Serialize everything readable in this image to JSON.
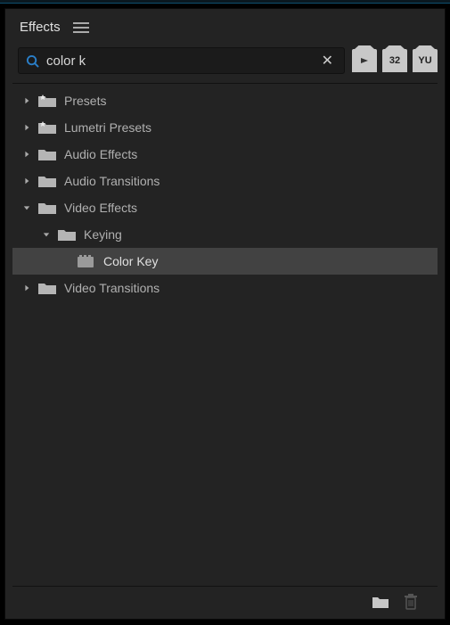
{
  "panel": {
    "title": "Effects"
  },
  "search": {
    "value": "color k",
    "placeholder": ""
  },
  "filters": {
    "fx": "▸",
    "accelerated": "32",
    "yuv": "YU"
  },
  "tree": [
    {
      "label": "Presets",
      "type": "preset-folder",
      "level": 0,
      "expanded": false,
      "hasChildren": true,
      "selected": false
    },
    {
      "label": "Lumetri Presets",
      "type": "preset-folder",
      "level": 0,
      "expanded": false,
      "hasChildren": true,
      "selected": false
    },
    {
      "label": "Audio Effects",
      "type": "folder",
      "level": 0,
      "expanded": false,
      "hasChildren": true,
      "selected": false
    },
    {
      "label": "Audio Transitions",
      "type": "folder",
      "level": 0,
      "expanded": false,
      "hasChildren": true,
      "selected": false
    },
    {
      "label": "Video Effects",
      "type": "folder",
      "level": 0,
      "expanded": true,
      "hasChildren": true,
      "selected": false
    },
    {
      "label": "Keying",
      "type": "folder",
      "level": 1,
      "expanded": true,
      "hasChildren": true,
      "selected": false
    },
    {
      "label": "Color Key",
      "type": "effect",
      "level": 2,
      "expanded": false,
      "hasChildren": false,
      "selected": true
    },
    {
      "label": "Video Transitions",
      "type": "folder",
      "level": 0,
      "expanded": false,
      "hasChildren": true,
      "selected": false
    }
  ]
}
